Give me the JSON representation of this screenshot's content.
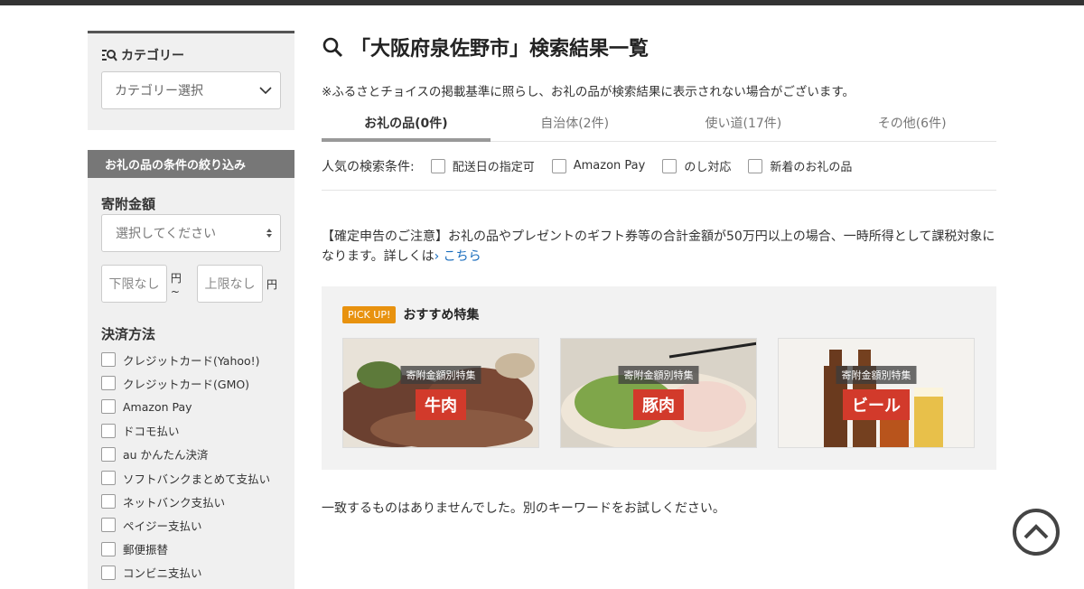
{
  "sidebar": {
    "category_title": "カテゴリー",
    "category_select": "カテゴリー選択",
    "filter_header": "お礼の品の条件の絞り込み",
    "amount_label": "寄附金額",
    "amount_select": "選択してください",
    "min_placeholder": "下限なし",
    "min_unit": "円 ~",
    "max_placeholder": "上限なし",
    "max_unit": "円",
    "payment_title": "決済方法",
    "payment_methods": [
      "クレジットカード(Yahoo!)",
      "クレジットカード(GMO)",
      "Amazon Pay",
      "ドコモ払い",
      "au かんたん決済",
      "ソフトバンクまとめて支払い",
      "ネットバンク支払い",
      "ペイジー支払い",
      "郵便振替",
      "コンビニ支払い"
    ]
  },
  "main": {
    "title": "「大阪府泉佐野市」検索結果一覧",
    "notice": "※ふるさとチョイスの掲載基準に照らし、お礼の品が検索結果に表示されない場合がございます。",
    "tabs": [
      {
        "label": "お礼の品(0件)"
      },
      {
        "label": "自治体(2件)"
      },
      {
        "label": "使い道(17件)"
      },
      {
        "label": "その他(6件)"
      }
    ],
    "popular_label": "人気の検索条件:",
    "popular_options": [
      "配送日の指定可",
      "Amazon Pay",
      "のし対応",
      "新着のお礼の品"
    ],
    "tax_notice": "【確定申告のご注意】お礼の品やプレゼントのギフト券等の合計金額が50万円以上の場合、一時所得として課税対象になります。詳しくは",
    "tax_link": "› こちら",
    "pickup_badge": "PICK UP!",
    "pickup_title": "おすすめ特集",
    "cards": [
      {
        "chip": "寄附金額別特集",
        "name": "牛肉"
      },
      {
        "chip": "寄附金額別特集",
        "name": "豚肉"
      },
      {
        "chip": "寄附金額別特集",
        "name": "ビール"
      }
    ],
    "no_result": "一致するものはありませんでした。別のキーワードをお試しください。"
  }
}
